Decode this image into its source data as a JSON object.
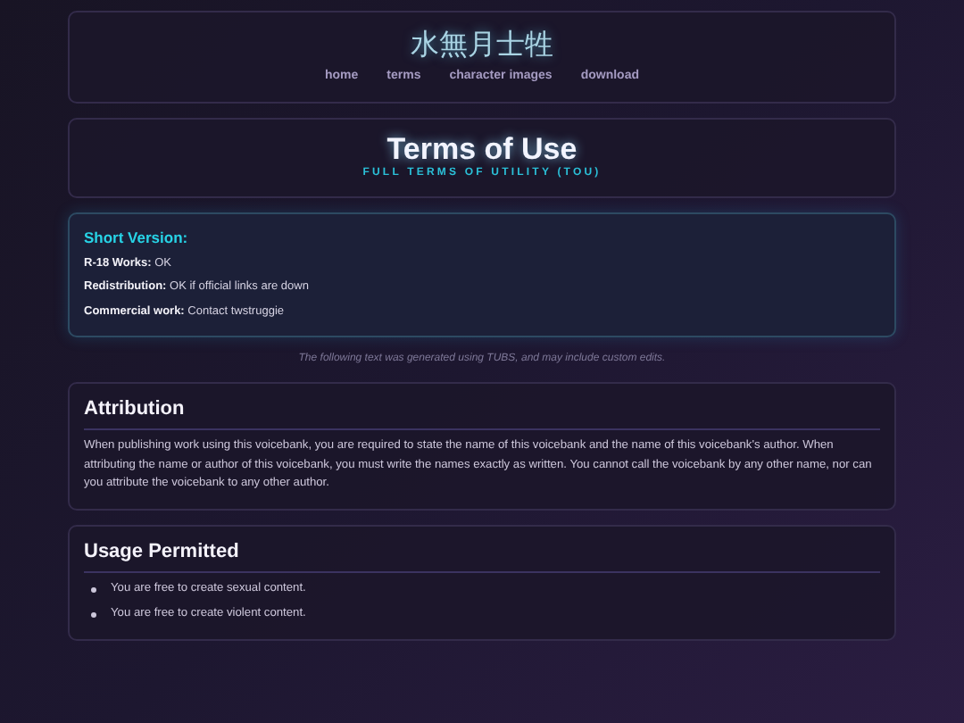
{
  "site": {
    "title": "水無月士牲",
    "nav": [
      "home",
      "terms",
      "character images",
      "download"
    ]
  },
  "header": {
    "title": "Terms of Use",
    "subtitle": "FULL TERMS OF UTILITY (TOU)"
  },
  "short_version": {
    "heading": "Short Version:",
    "items": [
      "**R-18 Works:** OK",
      "**Redistribution:** OK if official links are down",
      "**Commercial work:** Contact twstruggie"
    ]
  },
  "note": "The following text was generated using TUBS, and may include custom edits.",
  "sections": [
    {
      "kind": "paragraph",
      "heading": "Attribution",
      "text": "When publishing work using this voicebank, you are required to state the name of this voicebank and the name of this voicebank's author. When attributing the name or author of this voicebank, you must write the names exactly as written. You cannot call the voicebank by any other name, nor can you attribute the voicebank to any other author."
    },
    {
      "kind": "list",
      "heading": "Usage Permitted",
      "items": [
        "You are free to create sexual content.",
        "You are free to create violent content."
      ]
    }
  ]
}
